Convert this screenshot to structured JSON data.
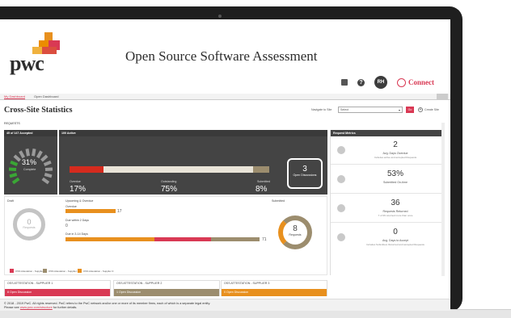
{
  "header": {
    "logo_text": "pwc",
    "app_title": "Open Source Software Assessment",
    "user_initials": "RH",
    "connect_label": "Connect"
  },
  "tabs": [
    {
      "label": "My Dashboard",
      "active": true
    },
    {
      "label": "Open Dashboard",
      "active": false
    }
  ],
  "page": {
    "title": "Cross-Site Statistics",
    "navigate_label": "Navigate to Site",
    "select_value": "Select",
    "go_label": "Go",
    "create_site_label": "Create Site",
    "section_label": "REQUESTS"
  },
  "kpis": {
    "accepted_header": "45 of 147 Accepted",
    "accepted_pct": "31%",
    "accepted_sub": "Complete",
    "accepted_fraction": 0.31,
    "active_header": "100 Active",
    "overdue_label": "Overdue",
    "overdue_value": "17%",
    "outstanding_label": "Outstanding",
    "outstanding_value": "75%",
    "submitted_label": "Submitted",
    "submitted_value": "8%",
    "bar_fractions": {
      "overdue": 0.17,
      "outstanding": 0.75,
      "submitted": 0.08
    },
    "open_discussions_count": "3",
    "open_discussions_label": "Open Discussions"
  },
  "lower": {
    "draft_label": "Draft",
    "draft_count": "0",
    "draft_sub": "Requests",
    "upcoming_title": "Upcoming & Overdue",
    "overdue_label": "Overdue",
    "overdue_count": "17",
    "due2_label": "Due within 2 Days",
    "due2_count": "0",
    "due3_label": "Due in 3-14 Days",
    "due3_count": "71",
    "submitted_label": "Submitted",
    "submitted_count": "8",
    "submitted_sub": "Requests",
    "legend": [
      {
        "label": "OSS Attestation - Supplier 1",
        "color": "#d93954"
      },
      {
        "label": "OSS Attestation - Supplier 2",
        "color": "#9c8d6e"
      },
      {
        "label": "OSS Attestation - Supplier 3",
        "color": "#e8901e"
      }
    ]
  },
  "metrics": {
    "header": "Request Metrics",
    "rows": [
      {
        "value": "2",
        "label": "Avg. Days Overdue",
        "note": "Includes active and accepted Requests"
      },
      {
        "value": "53%",
        "label": "Submitted On-time",
        "note": ""
      },
      {
        "value": "36",
        "label": "Requests Returned",
        "note": "7 of 36 returned more than once"
      },
      {
        "value": "0",
        "label": "Avg. Days to Accept",
        "note": "Includes Submitted, Returned and accepted Requests"
      }
    ]
  },
  "suppliers": [
    {
      "title": "OSS ATTESTATION - SUPPLIER 1",
      "status": "8 Open Discussion",
      "color": "#d93954"
    },
    {
      "title": "OSS ATTESTATION - SUPPLIER 2",
      "status": "1 Open Discussion",
      "color": "#9c8d6e"
    },
    {
      "title": "OSS ATTESTATION - SUPPLIER 3",
      "status": "0 Open Discussion",
      "color": "#e8901e"
    }
  ],
  "footer": {
    "line1": "© 2018 - 2019 PwC. All rights reserved. PwC refers to the PwC network and/or one or more of its member firms, each of which is a separate legal entity.",
    "line2_prefix": "Please see ",
    "link": "www.pwc.com/structure",
    "line2_suffix": " for further details."
  },
  "colors": {
    "accent": "#d93954",
    "dark_panel": "#444444",
    "orange": "#e8901e",
    "brown": "#9c8d6e",
    "red": "#d52b1e"
  }
}
